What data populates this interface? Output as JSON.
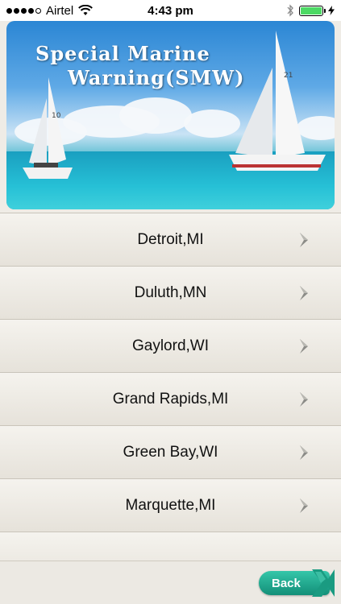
{
  "status_bar": {
    "carrier": "Airtel",
    "time": "4:43 pm",
    "signal_icon": "signal-dots-icon",
    "wifi_icon": "wifi-icon",
    "bluetooth_icon": "bluetooth-icon",
    "battery_icon": "battery-icon",
    "battery_color": "#4cd964"
  },
  "banner": {
    "title_line1": "Special Marine",
    "title_line2": "Warning(SMW)"
  },
  "locations": [
    {
      "label": "Detroit,MI"
    },
    {
      "label": "Duluth,MN"
    },
    {
      "label": "Gaylord,WI"
    },
    {
      "label": "Grand Rapids,MI"
    },
    {
      "label": "Green Bay,WI"
    },
    {
      "label": "Marquette,MI"
    }
  ],
  "bottom_bar": {
    "back_label": "Back",
    "accent_color": "#1fa88c"
  }
}
